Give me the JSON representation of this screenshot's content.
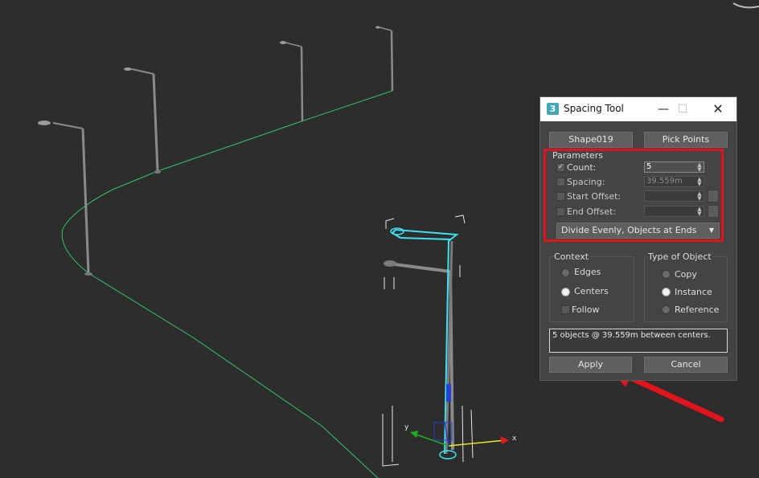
{
  "dialog": {
    "title": "Spacing Tool",
    "pick_path_label": "Shape019",
    "pick_points_label": "Pick Points",
    "parameters": {
      "section_label": "Parameters",
      "count": {
        "label": "Count:",
        "checked": true,
        "value": "5"
      },
      "spacing": {
        "label": "Spacing:",
        "checked": false,
        "value": "39.559m"
      },
      "start_offset": {
        "label": "Start Offset:",
        "checked": false,
        "value": ""
      },
      "end_offset": {
        "label": "End Offset:",
        "checked": false,
        "value": ""
      },
      "mode_dropdown": "Divide Evenly, Objects at Ends"
    },
    "context": {
      "section_label": "Context",
      "edges_label": "Edges",
      "centers_label": "Centers",
      "follow_label": "Follow",
      "selected": "Centers"
    },
    "type_of_object": {
      "section_label": "Type of Object",
      "copy_label": "Copy",
      "instance_label": "Instance",
      "reference_label": "Reference",
      "selected": "Instance"
    },
    "status_text": "5 objects @ 39.559m  between centers.",
    "apply_label": "Apply",
    "cancel_label": "Cancel"
  },
  "viewport": {
    "gizmo_x_label": "x",
    "gizmo_y_label": "y"
  },
  "colors": {
    "viewport_bg": "#2d2d2d",
    "spline": "#2fc46a",
    "selection": "#3ce2ef",
    "highlight_annotation": "#e1141b"
  }
}
